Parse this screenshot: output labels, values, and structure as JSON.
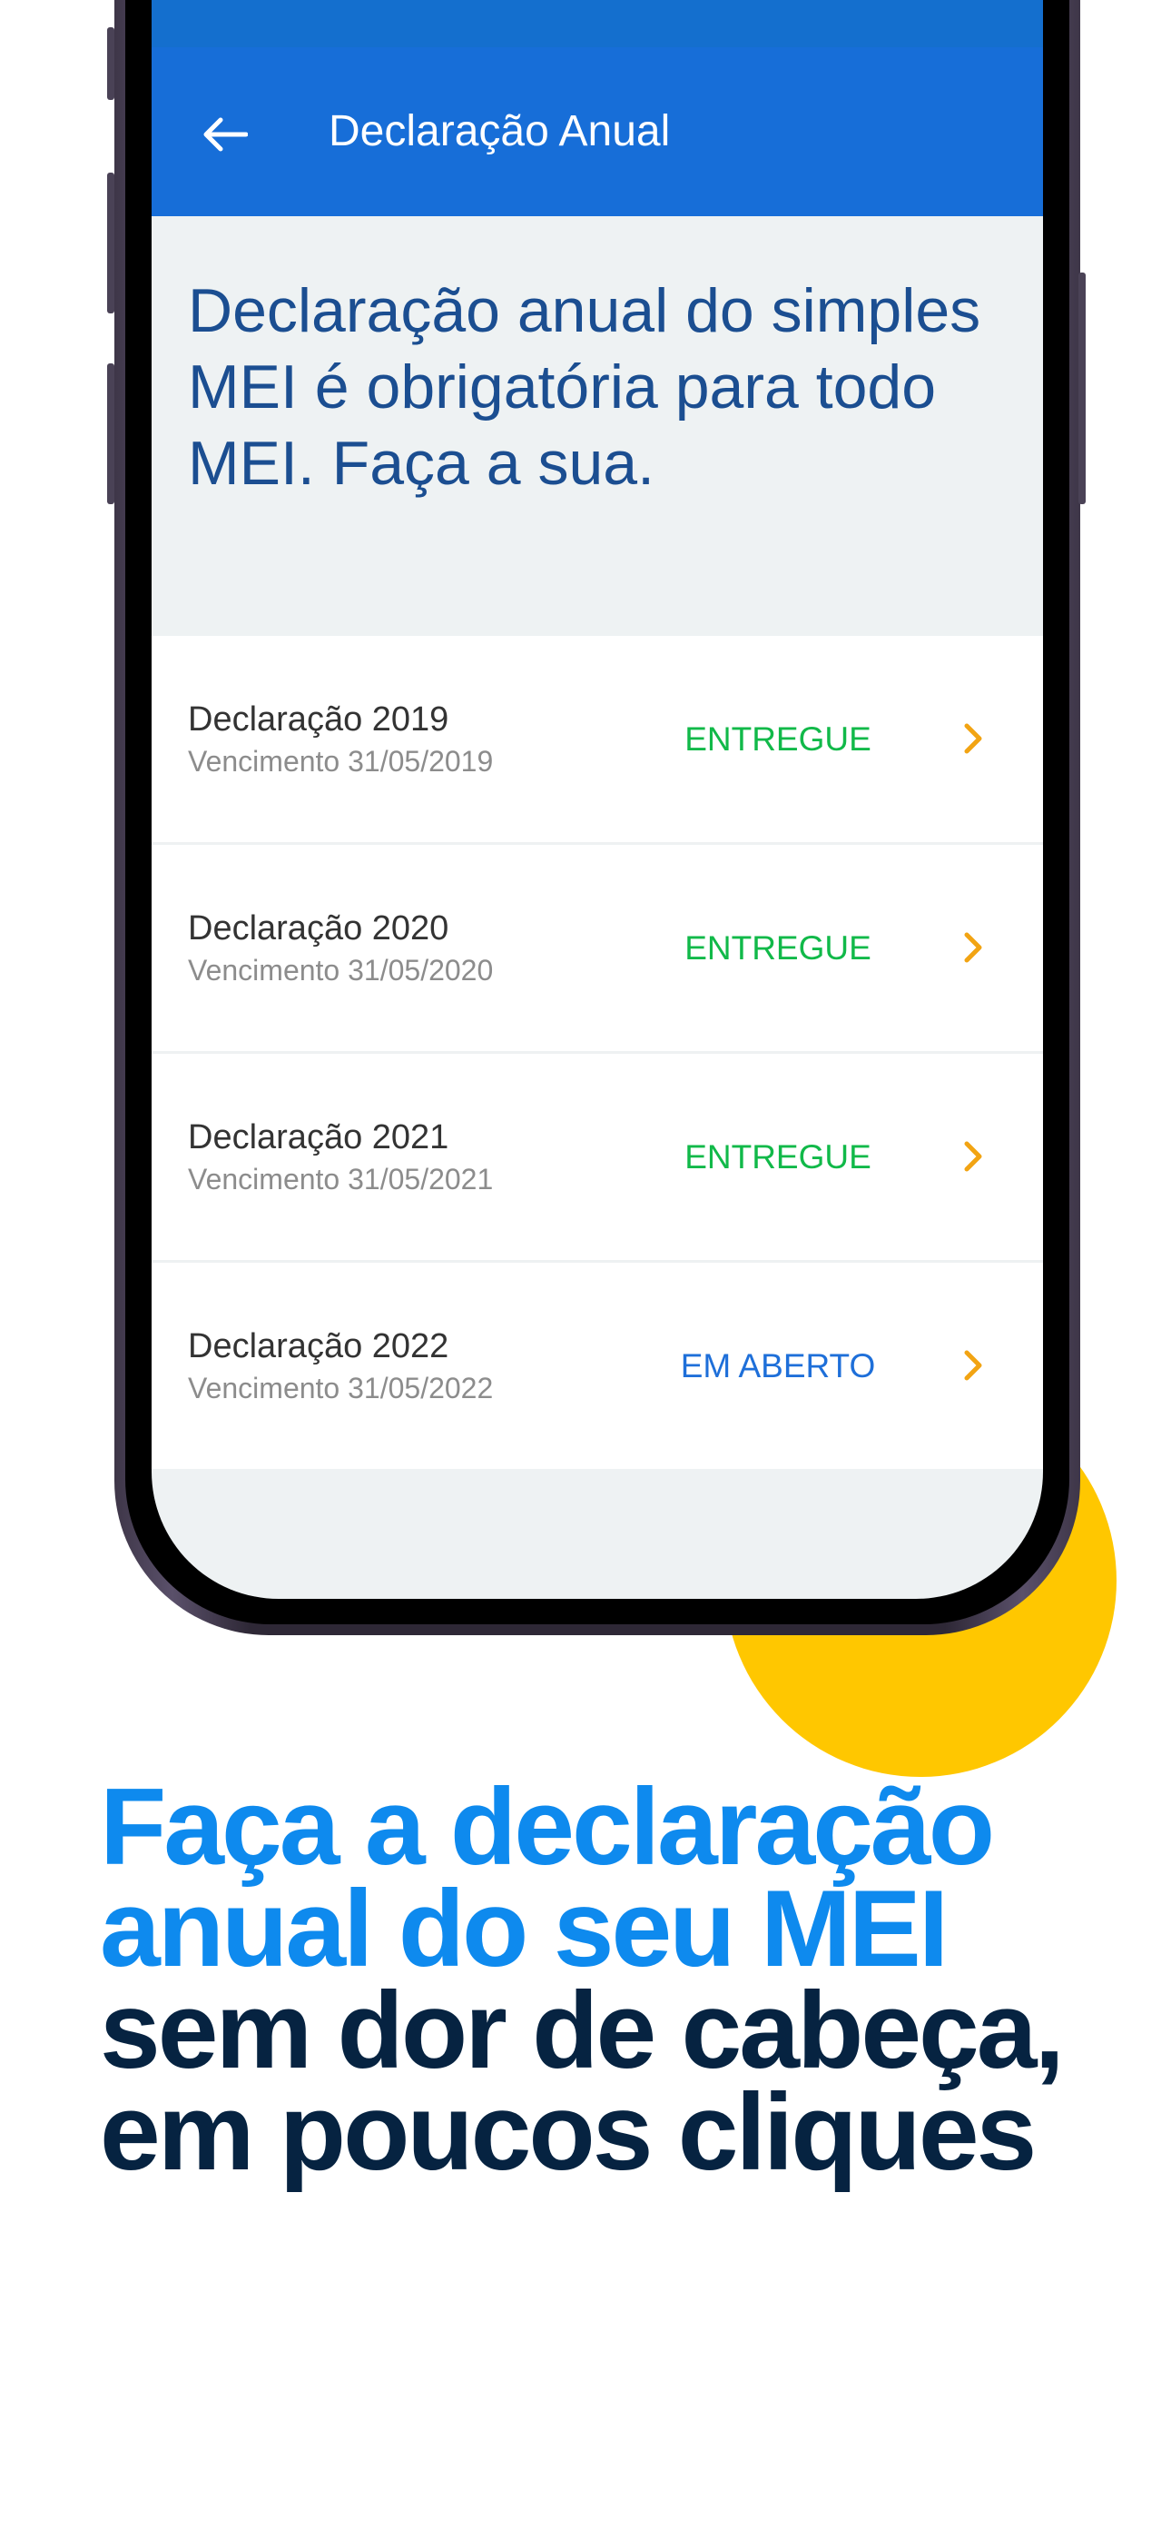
{
  "app_bar": {
    "title": "Declaração Anual",
    "back_icon": "arrow-left-icon"
  },
  "hero": {
    "text": "Declaração anual do simples MEI é obrigatória para todo MEI. Faça a sua."
  },
  "declarations": [
    {
      "title": "Declaração 2019",
      "due": "Vencimento 31/05/2019",
      "status": "ENTREGUE"
    },
    {
      "title": "Declaração 2020",
      "due": "Vencimento 31/05/2020",
      "status": "ENTREGUE"
    },
    {
      "title": "Declaração 2021",
      "due": "Vencimento 31/05/2021",
      "status": "ENTREGUE"
    },
    {
      "title": "Declaração 2022",
      "due": "Vencimento 31/05/2022",
      "status": "EM ABERTO"
    }
  ],
  "headline": {
    "line1": "Faça a declaração",
    "line2": "anual do seu MEI",
    "line3": "sem dor de cabeça,",
    "line4": "em poucos cliques"
  },
  "colors": {
    "app_bar": "#176ED8",
    "status_delivered": "#11B949",
    "status_open": "#1E6FD9",
    "chevron": "#F2A413",
    "accent_circle": "#FFC700",
    "headline_blue": "#0E8AEE",
    "headline_dark": "#062341"
  }
}
